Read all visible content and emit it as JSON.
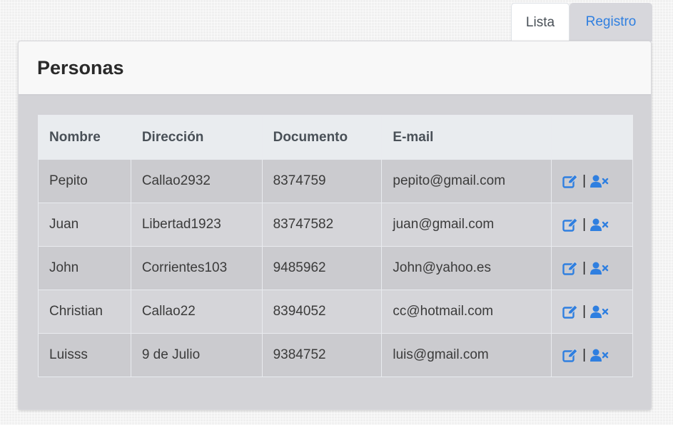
{
  "tabs": [
    {
      "label": "Lista",
      "active": true
    },
    {
      "label": "Registro",
      "active": false
    }
  ],
  "card": {
    "title": "Personas"
  },
  "table": {
    "headers": [
      "Nombre",
      "Dirección",
      "Documento",
      "E-mail",
      ""
    ],
    "rows": [
      {
        "nombre": "Pepito",
        "direccion": "Callao2932",
        "documento": "8374759",
        "email": "pepito@gmail.com"
      },
      {
        "nombre": "Juan",
        "direccion": "Libertad1923",
        "documento": "83747582",
        "email": "juan@gmail.com"
      },
      {
        "nombre": "John",
        "direccion": "Corrientes103",
        "documento": "9485962",
        "email": "John@yahoo.es"
      },
      {
        "nombre": "Christian",
        "direccion": "Callao22",
        "documento": "8394052",
        "email": "cc@hotmail.com"
      },
      {
        "nombre": "Luisss",
        "direccion": "9 de Julio",
        "documento": "9384752",
        "email": "luis@gmail.com"
      }
    ],
    "action_separator": "|",
    "action_icons": [
      "edit-icon",
      "remove-user-icon"
    ]
  },
  "colors": {
    "accent": "#2f7fe0",
    "header_bg": "#e9ecef",
    "card_body_bg": "#d3d3d7"
  }
}
